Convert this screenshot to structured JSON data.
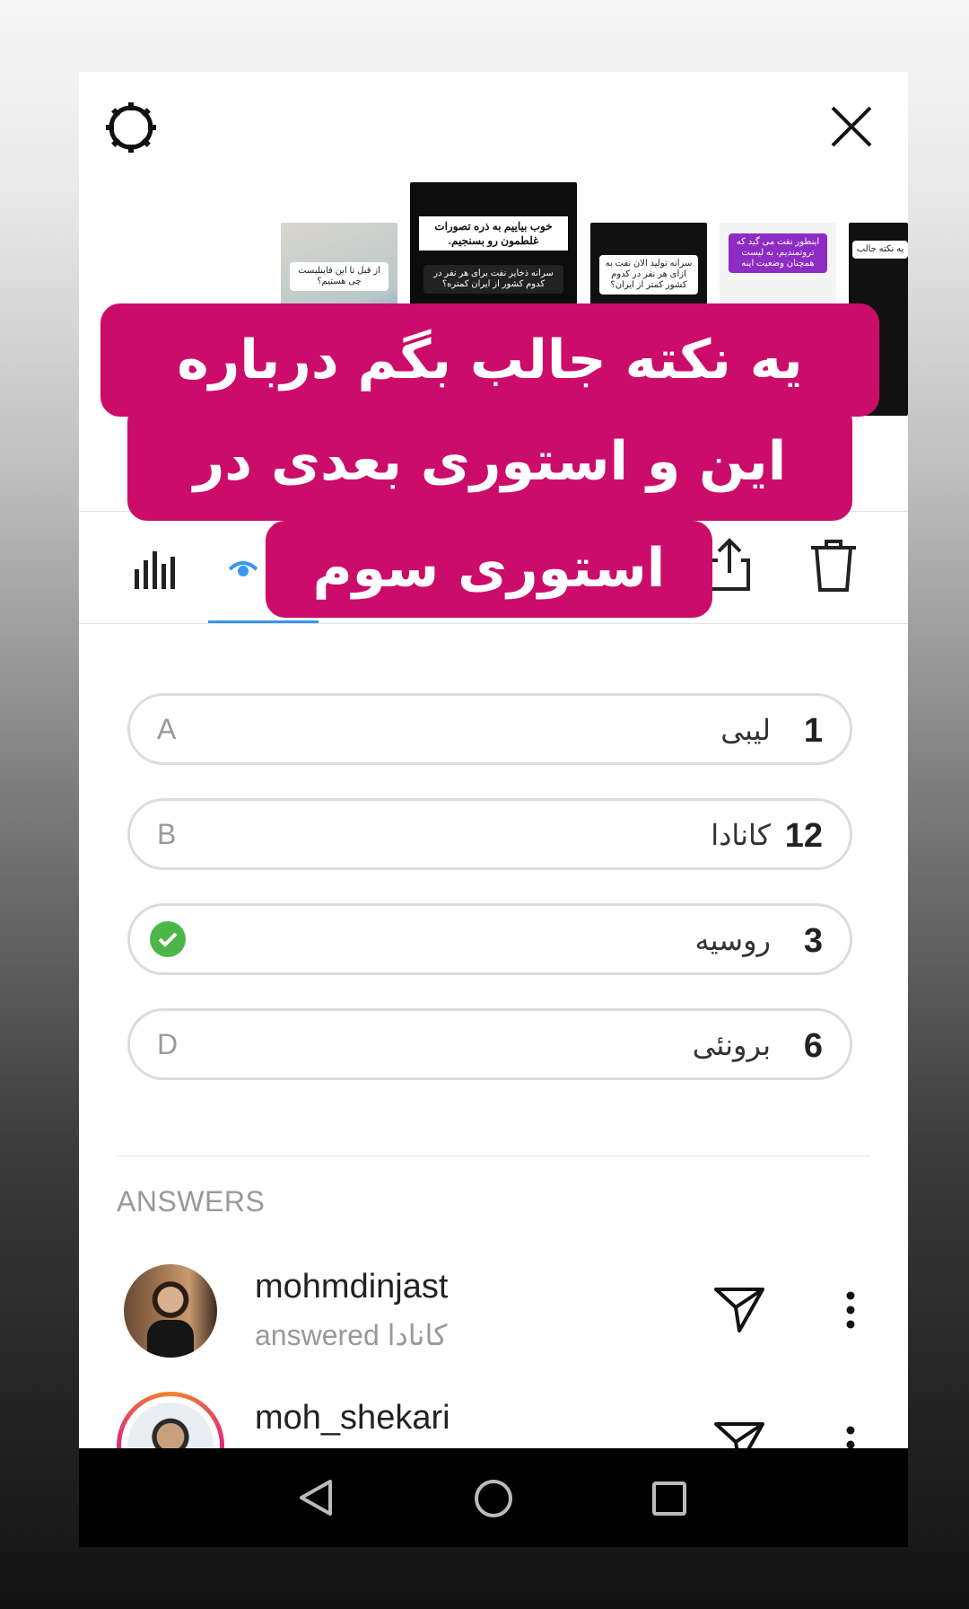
{
  "overlay": {
    "line1": "یه نکته جالب بگم درباره",
    "line2": "این و استوری بعدی در",
    "line3": "استوری سوم",
    "color": "#cc0c6b"
  },
  "thumbnails": [
    {
      "caption": "از قبل تا این فاینلیست چی هستیم؟"
    },
    {
      "caption_top": "خوب بیاییم به ذره تصورات غلطمون رو بسنجیم.",
      "caption": "سرانه ذخایر نفت برای هر نفر در کدوم کشور از ایران کمتره؟"
    },
    {
      "caption": "سرانه تولید الان نفت به ازای هر نفر در کدوم کشور کمتر از ایران؟"
    },
    {
      "caption": "اینطور نفت می گید که تروتمندیم، به لیست همچنان وضعیت اینه"
    },
    {
      "caption": "یه نکته جالب"
    }
  ],
  "poll": {
    "options": [
      {
        "letter": "A",
        "label": "لیبی",
        "count": "1",
        "correct": false
      },
      {
        "letter": "B",
        "label": "کانادا",
        "count": "12",
        "correct": false
      },
      {
        "letter": "",
        "label": "روسیه",
        "count": "3",
        "correct": true
      },
      {
        "letter": "D",
        "label": "برونئی",
        "count": "6",
        "correct": false
      }
    ]
  },
  "answers": {
    "title": "ANSWERS",
    "items": [
      {
        "username": "mohmdinjast",
        "sub_prefix": "answered",
        "answer": "کانادا"
      },
      {
        "username": "moh_shekari",
        "sub_prefix": "",
        "answer": ""
      }
    ]
  },
  "icons": {
    "settings": "gear-icon",
    "close": "close-icon",
    "stats": "bar-chart-icon",
    "viewers": "eye-icon",
    "share": "share-icon",
    "delete": "trash-icon",
    "send": "send-icon",
    "more": "more-vertical-icon"
  },
  "colors": {
    "accent": "#3897f0",
    "correct": "#4cb749"
  }
}
